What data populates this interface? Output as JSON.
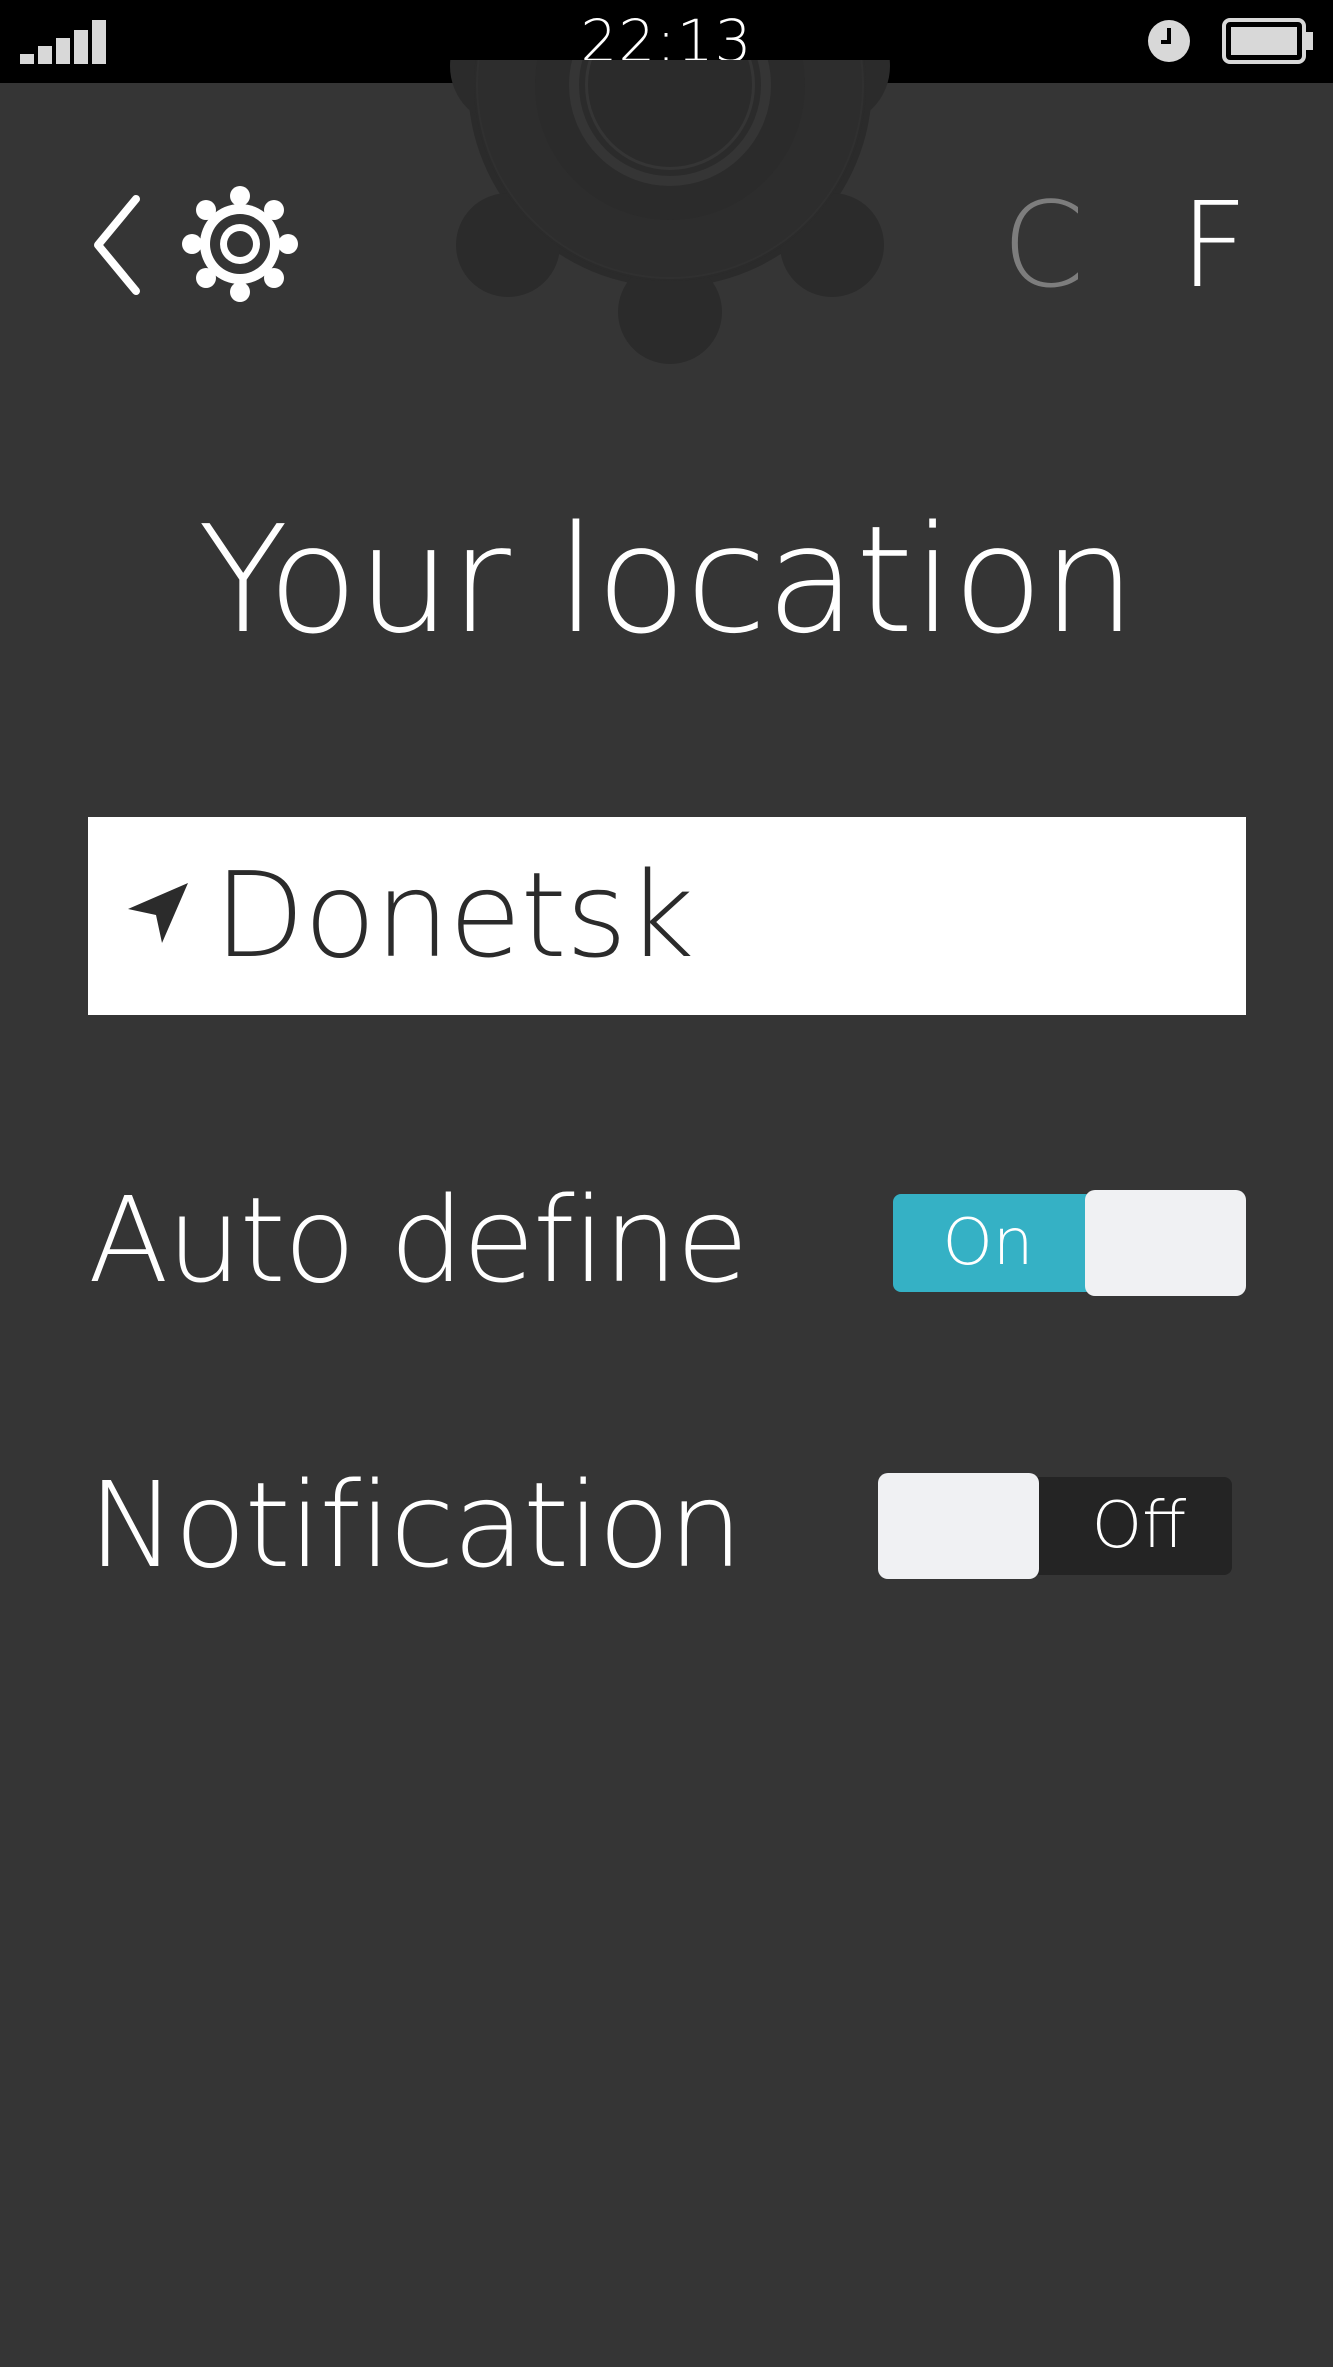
{
  "status_bar": {
    "time": "22:13",
    "icons": [
      "signal-icon",
      "alarm-icon",
      "battery-icon"
    ]
  },
  "header": {
    "back_icon": "back-chevron-icon",
    "settings_icon": "gear-icon",
    "units": [
      {
        "label": "C",
        "selected": false
      },
      {
        "label": "F",
        "selected": true
      }
    ]
  },
  "page": {
    "title": "Your location"
  },
  "location": {
    "icon": "location-arrow-icon",
    "value": "Donetsk"
  },
  "settings": {
    "auto_define": {
      "label": "Auto define",
      "state_text": "On",
      "enabled": true
    },
    "notification": {
      "label": "Notification",
      "state_text": "Off",
      "enabled": false
    }
  },
  "colors": {
    "background": "#353535",
    "status_bar": "#000000",
    "accent": "#35b1c5",
    "toggle_off_track": "#242424",
    "knob": "#f0f1f3",
    "unit_inactive": "#7d7d7d"
  }
}
